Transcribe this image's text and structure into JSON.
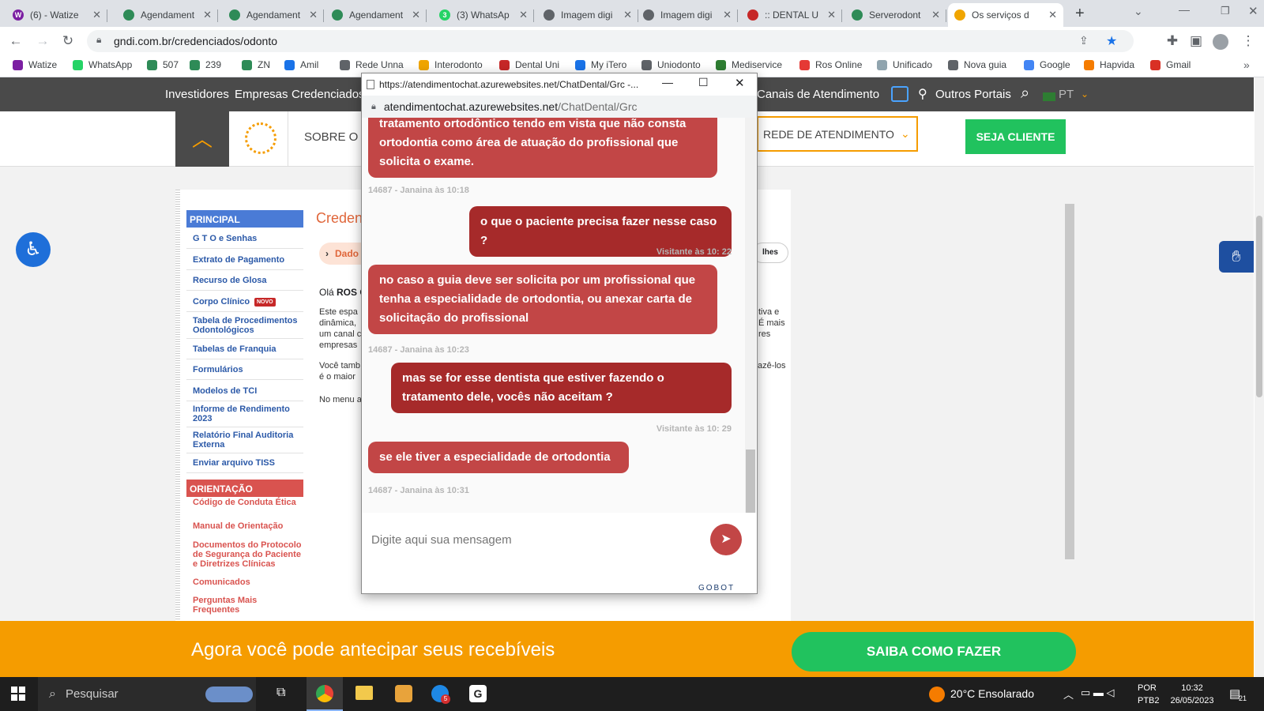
{
  "browser": {
    "tabs": [
      {
        "title": "(6) - Watize",
        "color": "#7b1fa2",
        "glyph": "W"
      },
      {
        "title": "Agendament",
        "color": "#2e8b57",
        "glyph": ""
      },
      {
        "title": "Agendament",
        "color": "#2e8b57",
        "glyph": ""
      },
      {
        "title": "Agendament",
        "color": "#2e8b57",
        "glyph": ""
      },
      {
        "title": "(3) WhatsAp",
        "color": "#25d366",
        "glyph": "3"
      },
      {
        "title": "Imagem digi",
        "color": "#5f6368",
        "glyph": ""
      },
      {
        "title": "Imagem digi",
        "color": "#5f6368",
        "glyph": ""
      },
      {
        "title": ":: DENTAL U",
        "color": "#c62828",
        "glyph": ""
      },
      {
        "title": "Serverodont",
        "color": "#2e8b57",
        "glyph": ""
      },
      {
        "title": "Os serviços d",
        "color": "#f0a500",
        "glyph": ""
      }
    ],
    "url": "gndi.com.br/credenciados/odonto",
    "bookmarks": [
      {
        "label": "Watize",
        "color": "#7b1fa2"
      },
      {
        "label": "WhatsApp",
        "color": "#25d366"
      },
      {
        "label": "507",
        "color": "#2e8b57"
      },
      {
        "label": "239",
        "color": "#2e8b57"
      },
      {
        "label": "ZN",
        "color": "#2e8b57"
      },
      {
        "label": "Amil",
        "color": "#1a73e8"
      },
      {
        "label": "Rede Unna",
        "color": "#5f6368"
      },
      {
        "label": "Interodonto",
        "color": "#f0a500"
      },
      {
        "label": "Dental Uni",
        "color": "#c62828"
      },
      {
        "label": "My iTero",
        "color": "#1a73e8"
      },
      {
        "label": "Uniodonto",
        "color": "#5f6368"
      },
      {
        "label": "Mediservice",
        "color": "#2e7d32"
      },
      {
        "label": "Ros Online",
        "color": "#e53935"
      },
      {
        "label": "Unificado",
        "color": "#90a4ae"
      },
      {
        "label": "Nova guia",
        "color": "#5f6368"
      },
      {
        "label": "Google",
        "color": "#4285f4"
      },
      {
        "label": "Hapvida",
        "color": "#f57c00"
      },
      {
        "label": "Gmail",
        "color": "#d93025"
      }
    ],
    "new_tab": "+",
    "more_bookmarks": "»"
  },
  "site": {
    "topnav": [
      "Investidores",
      "Empresas",
      "Credenciados"
    ],
    "canais": "Canais de Atendimento",
    "outros": "Outros Portais",
    "lang": "PT",
    "sobre": "SOBRE O G",
    "rede": "REDE DE ATENDIMENTO",
    "seja": "SEJA CLIENTE",
    "menu_principal": "PRINCIPAL",
    "menu_items": [
      "G T O  e  Senhas",
      "Extrato de Pagamento",
      "Recurso de Glosa",
      "Corpo Clínico",
      "Tabela de Procedimentos Odontológicos",
      "Tabelas de Franquia",
      "Formulários",
      "Modelos de TCI",
      "Informe de Rendimento 2023",
      "Relatório Final Auditoria Externa",
      "Enviar arquivo TISS"
    ],
    "novo_badge": "NOVO",
    "menu_orientacao": "ORIENTAÇÃO",
    "orient_items": [
      "Código de Conduta Ética",
      "Manual de Orientação",
      "Documentos do Protocolo de Segurança do Paciente e Diretrizes Clínicas",
      "Comunicados",
      "Perguntas Mais Frequentes"
    ],
    "main_title": "Credenc",
    "dados_btn": "Dado",
    "detalhes": "lhes",
    "ola_prefix": "Olá ",
    "ola_name": "ROS C",
    "para1": "Este espa\ndinâmica,\num canal c\nempresas",
    "para1_right": "tiva e\nÉ mais\nres",
    "para2": "Você tamb\né o maior",
    "para2_right": "fazê-los",
    "para3": "No menu a",
    "banner_text": "Agora você pode antecipar seus recebíveis",
    "banner_btn": "SAIBA COMO FAZER"
  },
  "chat": {
    "window_url": "https://atendimentochat.azurewebsites.net/ChatDental/Grc -...",
    "address_host": "atendimentochat.azurewebsites.net",
    "address_path": "/ChatDental/Grc",
    "messages": [
      {
        "from": "agent",
        "text": "tratamento ortodôntico tendo em vista que não consta ortodontia como área de atuação do profissional que solicita o exame.",
        "meta": "14687 - Janaina às 10:18"
      },
      {
        "from": "visitor",
        "text": "o que o paciente precisa fazer nesse caso ?",
        "meta": "Visitante às 10: 22"
      },
      {
        "from": "agent",
        "text": "no caso a guia deve ser solicita por um profissional que tenha a especialidade de ortodontia, ou anexar carta de solicitação do profissional",
        "meta": "14687 - Janaina às 10:23"
      },
      {
        "from": "visitor",
        "text": "mas se for esse dentista que estiver fazendo o tratamento dele, vocês não aceitam ?",
        "meta": "Visitante às 10: 29"
      },
      {
        "from": "agent",
        "text": "se ele tiver a especialidade de ortodontia",
        "meta": "14687 - Janaina às 10:31"
      }
    ],
    "input_placeholder": "Digite aqui sua mensagem",
    "brand": "GOBOT"
  },
  "taskbar": {
    "search": "Pesquisar",
    "weather": "20°C  Ensolarado",
    "lang1": "POR",
    "lang2": "PTB2",
    "time": "10:32",
    "date": "26/05/2023",
    "notif": "21",
    "skype_badge": "5"
  }
}
